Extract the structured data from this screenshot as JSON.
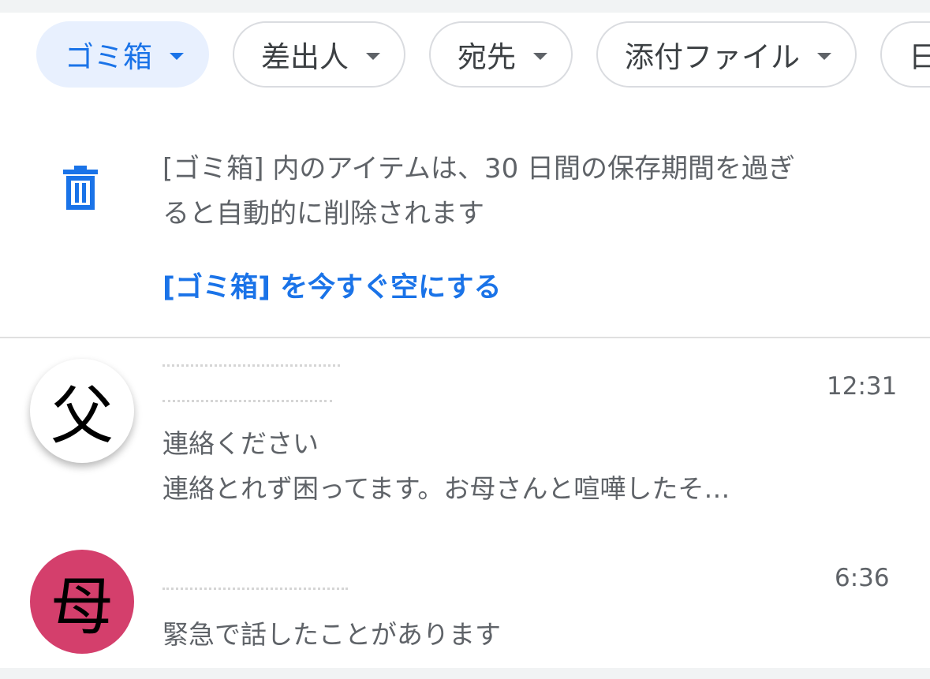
{
  "filters": {
    "chips": [
      {
        "label": "ゴミ箱",
        "selected": true
      },
      {
        "label": "差出人",
        "selected": false
      },
      {
        "label": "宛先",
        "selected": false
      },
      {
        "label": "添付ファイル",
        "selected": false
      },
      {
        "label": "日",
        "selected": false
      }
    ]
  },
  "trash_notice": {
    "icon": "trash-icon",
    "line1": "[ゴミ箱] 内のアイテムは、30 日間の保存期間を過ぎ",
    "line2": "ると自動的に削除されます",
    "empty_link": "[ゴミ箱] を今すぐ空にする"
  },
  "mails": [
    {
      "avatar_char": "父",
      "avatar_color": "#ffffff",
      "time": "12:31",
      "subject": "連絡ください",
      "snippet": "連絡とれず困ってます。お母さんと喧嘩したそ…"
    },
    {
      "avatar_char": "母",
      "avatar_color": "#d43f6c",
      "time": "6:36",
      "subject": "緊急で話したことがあります"
    }
  ],
  "colors": {
    "accent": "#1a73e8",
    "chip_selected_bg": "#e8f0fe",
    "text_secondary": "#5f6368"
  }
}
